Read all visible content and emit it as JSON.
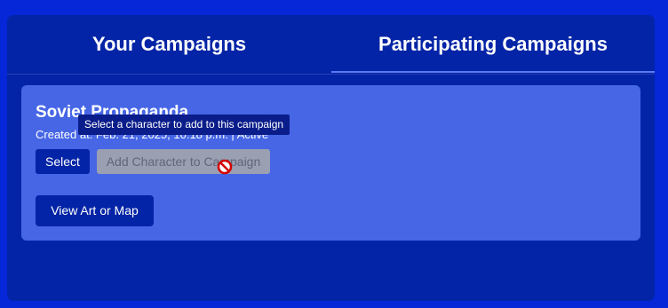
{
  "tabs": [
    {
      "label": "Your Campaigns",
      "active": false
    },
    {
      "label": "Participating Campaigns",
      "active": true
    }
  ],
  "campaign": {
    "title": "Soviet Propaganda",
    "meta": "Created at: Feb. 21, 2025, 10:18 p.m. | Active",
    "select_label": "Select",
    "add_character_label": "Add Character to Campaign",
    "view_art_label": "View Art or Map"
  },
  "tooltip": {
    "text": "Select a character to add to this campaign"
  },
  "cursor": {
    "icon": "not-allowed-cursor-icon"
  },
  "colors": {
    "background": "#0527d8",
    "panel": "#0324a6",
    "card": "#4666e6",
    "disabled_button": "#9aa0b2",
    "tab_underline": "#5b7cf0"
  }
}
